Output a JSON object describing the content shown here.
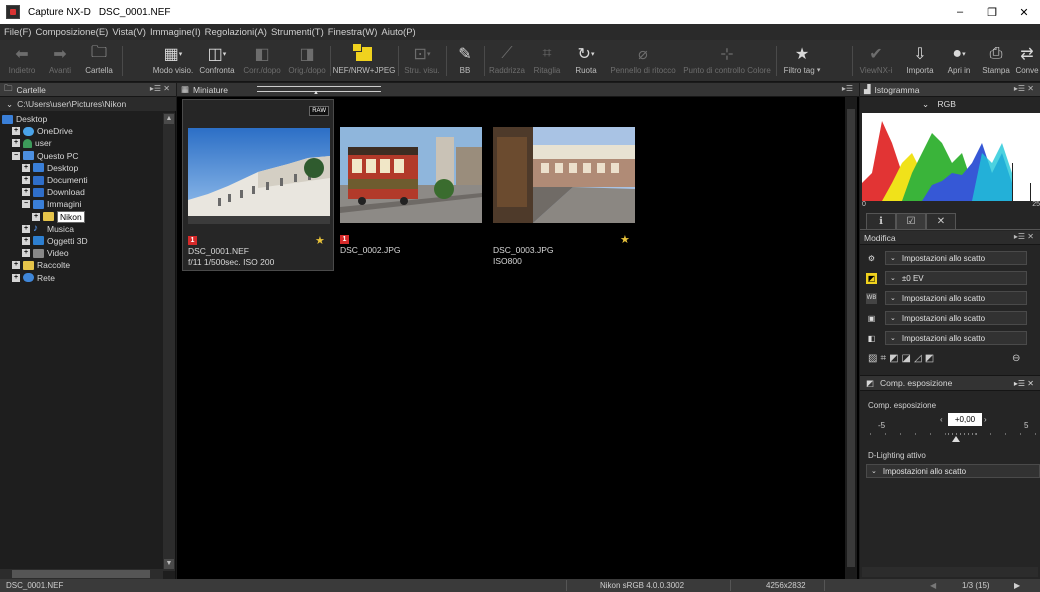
{
  "window": {
    "title_app": "Capture NX-D",
    "title_file": "DSC_0001.NEF",
    "minimize": "–",
    "restore": "❐",
    "close": "✕"
  },
  "menu": [
    "File(F)",
    "Composizione(E)",
    "Vista(V)",
    "Immagine(I)",
    "Regolazioni(A)",
    "Strumenti(T)",
    "Finestra(W)",
    "Aiuto(P)"
  ],
  "toolbar": {
    "back": "Indietro",
    "forward": "Avanti",
    "folder": "Cartella",
    "view_mode": "Modo visio.",
    "compare": "Confronta",
    "before_after": "Corr./dopo",
    "orig_after": "Orig./dopo",
    "nef_jpeg": "NEF/NRW+JPEG",
    "view_tools": "Stru. visu.",
    "bb": "BB",
    "straighten": "Raddrizza",
    "crop": "Ritaglia",
    "rotate": "Ruota",
    "retouch": "Pennello di ritocco",
    "color_control": "Punto di controllo Colore",
    "tag_filter": "Filtro tag",
    "viewnx": "ViewNX-i",
    "import": "Importa",
    "open_in": "Apri in",
    "print": "Stampa",
    "convert": "Conve"
  },
  "left": {
    "panel_title": "Cartelle",
    "path": "C:\\Users\\user\\Pictures\\Nikon",
    "tree": [
      {
        "label": "Desktop",
        "indent": 0,
        "exp": "",
        "icon": "blue"
      },
      {
        "label": "OneDrive",
        "indent": 1,
        "exp": "+",
        "icon": "cloud"
      },
      {
        "label": "user",
        "indent": 1,
        "exp": "+",
        "icon": "user"
      },
      {
        "label": "Questo PC",
        "indent": 1,
        "exp": "−",
        "icon": "pc"
      },
      {
        "label": "Desktop",
        "indent": 2,
        "exp": "+",
        "icon": "blue"
      },
      {
        "label": "Documenti",
        "indent": 2,
        "exp": "+",
        "icon": "blue2"
      },
      {
        "label": "Download",
        "indent": 2,
        "exp": "+",
        "icon": "blue2"
      },
      {
        "label": "Immagini",
        "indent": 2,
        "exp": "−",
        "icon": "blue"
      },
      {
        "label": "Nikon",
        "indent": 3,
        "exp": "+",
        "icon": "yellow",
        "selected": true
      },
      {
        "label": "Musica",
        "indent": 2,
        "exp": "+",
        "icon": "music"
      },
      {
        "label": "Oggetti 3D",
        "indent": 2,
        "exp": "+",
        "icon": "obj"
      },
      {
        "label": "Video",
        "indent": 2,
        "exp": "+",
        "icon": "vid"
      },
      {
        "label": "Raccolte",
        "indent": 1,
        "exp": "+",
        "icon": "yellow"
      },
      {
        "label": "Rete",
        "indent": 1,
        "exp": "+",
        "icon": "net"
      }
    ]
  },
  "center": {
    "panel_title": "Miniature",
    "thumbs": [
      {
        "name": "DSC_0001.NEF",
        "info": "f/11 1/500sec. ISO 200",
        "raw_badge": "RAW",
        "flag": "1",
        "star": true
      },
      {
        "name": "DSC_0002.JPG",
        "info": "",
        "flag": "1",
        "star": false
      },
      {
        "name": "DSC_0003.JPG",
        "info": "ISO800",
        "flag": "",
        "star": true
      }
    ]
  },
  "right": {
    "hist_title": "Istogramma",
    "hist_channel": "RGB",
    "hist_min": "0",
    "hist_max": "25",
    "edit_title": "Modifica",
    "rows": [
      {
        "icon": "gear-icon",
        "value": "Impostazioni allo scatto"
      },
      {
        "icon": "exposure-icon",
        "value": "±0 EV"
      },
      {
        "icon": "wb-icon",
        "value": "Impostazioni allo scatto"
      },
      {
        "icon": "picture-control-icon",
        "value": "Impostazioni allo scatto"
      },
      {
        "icon": "lens-icon",
        "value": "Impostazioni allo scatto"
      }
    ],
    "comp_title": "Comp. esposizione",
    "comp_label": "Comp. esposizione",
    "comp_value": "+0,00",
    "comp_min": "-5",
    "comp_max": "5",
    "dlighting_label": "D-Lighting attivo",
    "dlighting_value": "Impostazioni allo scatto"
  },
  "status": {
    "filename": "DSC_0001.NEF",
    "profile": "Nikon sRGB 4.0.0.3002",
    "size": "4256x2832",
    "page": "1/3 (15)"
  }
}
